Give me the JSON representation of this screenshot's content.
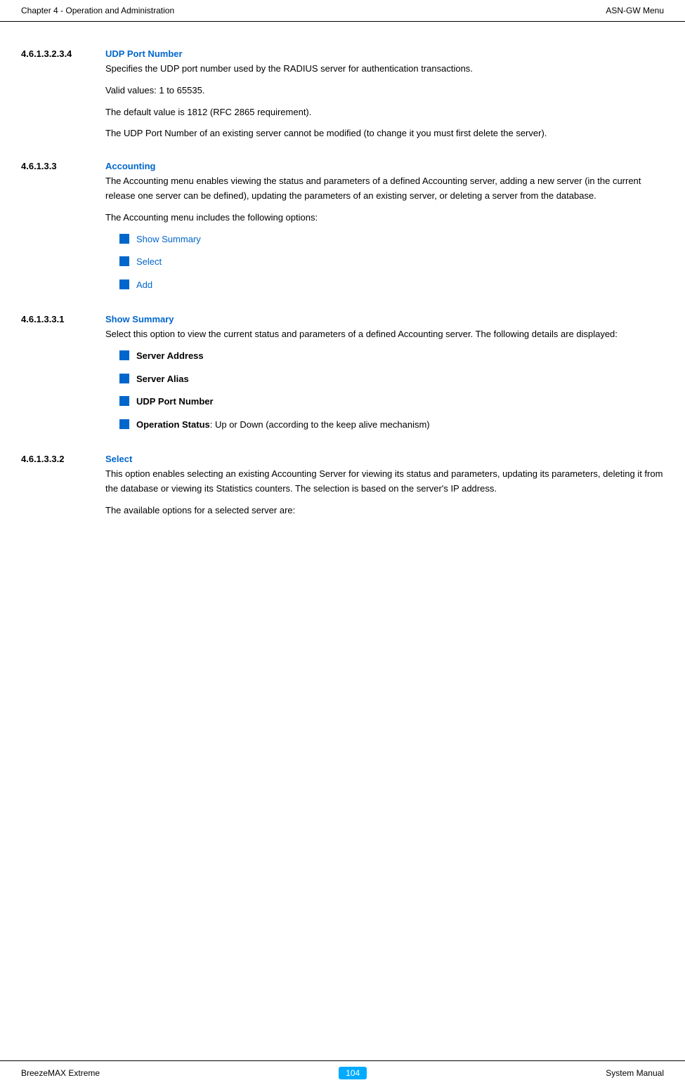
{
  "header": {
    "left": "Chapter 4 - Operation and Administration",
    "right": "ASN-GW Menu"
  },
  "footer": {
    "left": "BreezeMAX Extreme",
    "center": "104",
    "right": "System Manual"
  },
  "sections": [
    {
      "id": "4613234",
      "number": "4.6.1.3.2.3.4",
      "title": "UDP Port Number",
      "paragraphs": [
        "Specifies the UDP port number used by the RADIUS server for authentication transactions.",
        "Valid values: 1 to 65535.",
        "The default value is 1812 (RFC 2865 requirement).",
        "The UDP Port Number of an existing server cannot be modified (to change it you must first delete the server)."
      ]
    },
    {
      "id": "4613",
      "number": "4.6.1.3.3",
      "title": "Accounting",
      "paragraphs": [
        "The Accounting menu enables viewing the status and parameters of a defined Accounting server, adding a new server (in the current release one server can be defined), updating the parameters of an existing server, or deleting a server from the database.",
        "The Accounting menu includes the following options:"
      ],
      "bullets": [
        {
          "text": "Show Summary",
          "bold": false
        },
        {
          "text": "Select",
          "bold": false
        },
        {
          "text": "Add",
          "bold": false
        }
      ]
    },
    {
      "id": "461331",
      "number": "4.6.1.3.3.1",
      "title": "Show Summary",
      "paragraphs": [
        "Select this option to view the current status and parameters of a defined Accounting server. The following details are displayed:"
      ],
      "bullets": [
        {
          "text": "Server Address",
          "bold": true,
          "suffix": ""
        },
        {
          "text": "Server Alias",
          "bold": true,
          "suffix": ""
        },
        {
          "text": "UDP Port Number",
          "bold": true,
          "suffix": ""
        },
        {
          "text": "Operation Status",
          "bold": true,
          "suffix": ": Up or Down (according to the keep alive mechanism)"
        }
      ]
    },
    {
      "id": "461332",
      "number": "4.6.1.3.3.2",
      "title": "Select",
      "paragraphs": [
        "This option enables selecting an existing Accounting Server for viewing its status and parameters, updating its parameters, deleting it from the database or viewing its Statistics counters. The selection is based on the server's IP address.",
        "The available options for a selected server are:"
      ]
    }
  ]
}
